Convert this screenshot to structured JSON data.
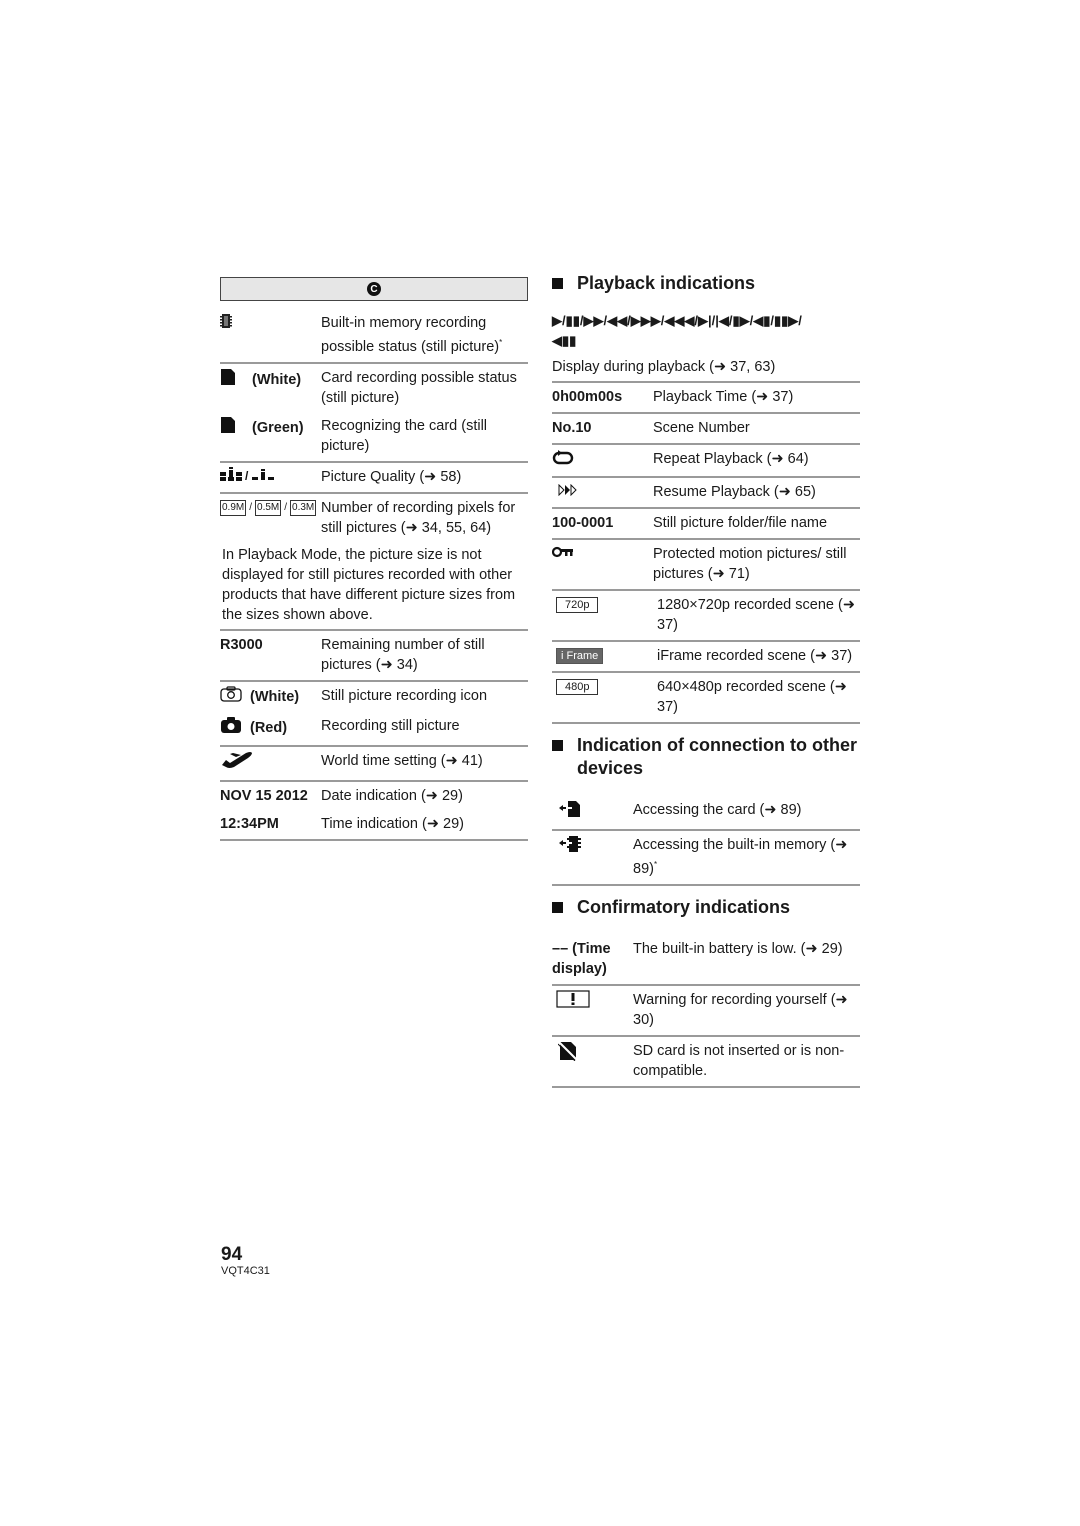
{
  "left": {
    "mode_icon": "C",
    "groups": [
      {
        "rows": [
          {
            "icon": "builtin-memory-icon",
            "qualifier": "",
            "desc": "Built-in memory recording possible status (still picture)",
            "footnote": "*"
          }
        ]
      },
      {
        "rows": [
          {
            "icon": "sd-card-icon",
            "qualifier": "(White)",
            "desc": "Card recording possible status (still picture)"
          },
          {
            "icon": "sd-card-icon",
            "qualifier": "(Green)",
            "desc": "Recognizing the card (still picture)"
          }
        ]
      },
      {
        "rows": [
          {
            "icon": "picture-quality-icon",
            "qualifier": "",
            "desc": "Picture Quality (➜ 58)"
          }
        ]
      },
      {
        "rows": [
          {
            "icon": "recording-pixels-icon",
            "labels": [
              "0.9M",
              "0.5M",
              "0.3M"
            ],
            "desc": "Number of recording pixels for still pictures (➜ 34, 55, 64)"
          }
        ]
      }
    ],
    "note": "In Playback Mode, the picture size is not displayed for still pictures recorded with other products that have different picture sizes from the sizes shown above.",
    "groups2": [
      {
        "rows": [
          {
            "label": "R3000",
            "desc": "Remaining number of still pictures (➜ 34)"
          }
        ]
      },
      {
        "rows": [
          {
            "icon": "camera-outline-icon",
            "qualifier": "(White)",
            "desc": "Still picture recording icon"
          },
          {
            "icon": "camera-filled-icon",
            "qualifier": "(Red)",
            "desc": "Recording still picture"
          }
        ]
      },
      {
        "rows": [
          {
            "icon": "airplane-icon",
            "desc": "World time setting (➜ 41)"
          }
        ]
      },
      {
        "rows": [
          {
            "label": "NOV 15 2012",
            "desc": "Date indication (➜ 29)"
          },
          {
            "label": "12:34PM",
            "desc": "Time indication (➜ 29)"
          }
        ]
      }
    ]
  },
  "right": {
    "playback": {
      "title": "Playback indications",
      "symbols": "▶/▮▮/▶▶/◀◀/▶▶▶/◀◀◀/▶|/|◀/▮▶/◀▮/▮▮▶/\n◀▮▮",
      "caption": "Display during playback (➜ 37, 63)",
      "rows": [
        {
          "label": "0h00m00s",
          "desc": "Playback Time (➜ 37)"
        },
        {
          "label": "No.10",
          "desc": "Scene Number"
        },
        {
          "icon": "repeat-icon",
          "desc": "Repeat Playback (➜ 64)"
        },
        {
          "icon": "resume-icon",
          "desc": "Resume Playback (➜ 65)"
        },
        {
          "label": "100-0001",
          "desc": "Still picture folder/file name"
        },
        {
          "icon": "protect-key-icon",
          "desc": "Protected motion pictures/ still pictures (➜ 71)"
        },
        {
          "badge": "720p",
          "desc": "1280×720p recorded scene (➜ 37)"
        },
        {
          "badge": "i Frame",
          "desc": "iFrame recorded scene (➜ 37)"
        },
        {
          "badge": "480p",
          "desc": "640×480p recorded scene (➜ 37)"
        }
      ]
    },
    "connection": {
      "title": "Indication of connection to other devices",
      "rows": [
        {
          "icon": "access-card-icon",
          "desc": "Accessing the card (➜ 89)"
        },
        {
          "icon": "access-memory-icon",
          "desc": "Accessing the built-in memory (➜ 89)",
          "footnote": "*"
        }
      ]
    },
    "confirmatory": {
      "title": "Confirmatory indications",
      "rows": [
        {
          "label": "–– (Time display)",
          "desc": "The built-in battery is low. (➜ 29)"
        },
        {
          "icon": "warning-box-icon",
          "desc": "Warning for recording yourself (➜ 30)"
        },
        {
          "icon": "no-sd-card-icon",
          "desc": "SD card is not inserted or is non-compatible."
        }
      ]
    }
  },
  "footer": {
    "page_number": "94",
    "code": "VQT4C31"
  }
}
